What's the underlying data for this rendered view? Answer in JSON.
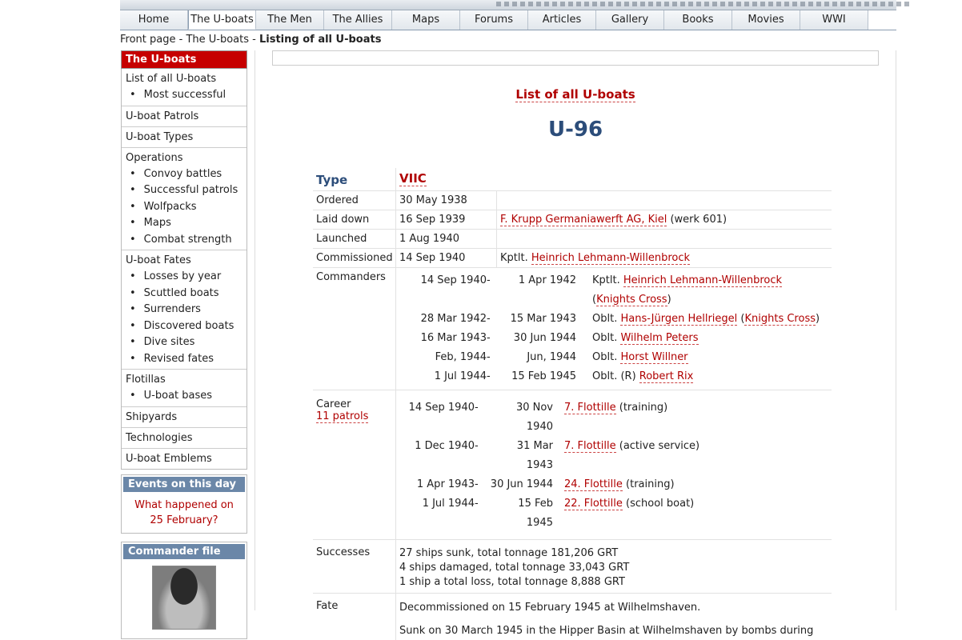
{
  "nav": [
    "Home",
    "The U-boats",
    "The Men",
    "The Allies",
    "Maps",
    "Forums",
    "Articles",
    "Gallery",
    "Books",
    "Movies",
    "WWI"
  ],
  "nav_active": 1,
  "breadcrumb": {
    "a": "Front page",
    "sep": " - ",
    "b": "The U-boats",
    "c": "Listing of all U-boats"
  },
  "sidebar": {
    "header": "The U-boats",
    "groups": [
      {
        "title": "List of all U-boats",
        "items": [
          "Most successful"
        ]
      },
      {
        "title": "U-boat Patrols",
        "items": []
      },
      {
        "title": "U-boat Types",
        "items": []
      },
      {
        "title": "Operations",
        "items": [
          "Convoy battles",
          "Successful patrols",
          "Wolfpacks",
          "Maps",
          "Combat strength"
        ]
      },
      {
        "title": "U-boat Fates",
        "items": [
          "Losses by year",
          "Scuttled boats",
          "Surrenders",
          "Discovered boats",
          "Dive sites",
          "Revised fates"
        ]
      },
      {
        "title": "Flotillas",
        "items": [
          "U-boat bases"
        ]
      },
      {
        "title": "Shipyards",
        "items": []
      },
      {
        "title": "Technologies",
        "items": []
      },
      {
        "title": "U-boat Emblems",
        "items": []
      }
    ],
    "events_title": "Events on this day",
    "events_text": "What happened on 25 February?",
    "commander_title": "Commander file"
  },
  "main": {
    "list_link": "List of all U-boats",
    "boat": "U-96",
    "type_label": "Type",
    "type_value": "VIIC",
    "ordered_label": "Ordered",
    "ordered_value": "30 May 1938",
    "laid_label": "Laid down",
    "laid_value": "16 Sep 1939",
    "laid_yard": "F. Krupp Germaniawerft AG, Kiel",
    "laid_extra": " (werk 601)",
    "launched_label": "Launched",
    "launched_value": "1 Aug 1940",
    "comm_label": "Commissioned",
    "comm_value": "14 Sep 1940",
    "comm_rank": "Kptlt. ",
    "comm_name": "Heinrich Lehmann-Willenbrock",
    "commanders_label": "Commanders",
    "commanders": [
      {
        "from": "14 Sep 1940",
        "to": "1 Apr 1942",
        "rank": "Kptlt. ",
        "name": "Heinrich Lehmann-Willenbrock",
        "award": "Knights Cross"
      },
      {
        "from": "28 Mar 1942",
        "to": "15 Mar 1943",
        "rank": "Oblt. ",
        "name": "Hans-Jürgen Hellriegel",
        "award": "Knights Cross"
      },
      {
        "from": "16 Mar 1943",
        "to": "30 Jun 1944",
        "rank": "Oblt. ",
        "name": "Wilhelm Peters",
        "award": ""
      },
      {
        "from": "Feb, 1944",
        "to": "Jun, 1944",
        "rank": "Oblt. ",
        "name": "Horst Willner",
        "award": ""
      },
      {
        "from": "1 Jul 1944",
        "to": "15 Feb 1945",
        "rank": "Oblt. (R) ",
        "name": "Robert Rix",
        "award": ""
      }
    ],
    "career_label": "Career",
    "career_patrols": "11 patrols",
    "career": [
      {
        "from": "14 Sep 1940",
        "to": "30 Nov 1940",
        "flot": "7. Flottille",
        "note": " (training)"
      },
      {
        "from": "1 Dec 1940",
        "to": "31 Mar 1943",
        "flot": "7. Flottille",
        "note": " (active service)"
      },
      {
        "from": "1 Apr 1943",
        "to": "30 Jun 1944",
        "flot": "24. Flottille",
        "note": " (training)"
      },
      {
        "from": "1 Jul 1944",
        "to": "15 Feb 1945",
        "flot": "22. Flottille",
        "note": " (school boat)"
      }
    ],
    "successes_label": "Successes",
    "successes": [
      "27 ships sunk, total tonnage 181,206 GRT",
      "4 ships damaged, total tonnage 33,043 GRT",
      "1 ship a total loss, total tonnage 8,888 GRT"
    ],
    "fate_label": "Fate",
    "fate": [
      "Decommissioned on 15 February 1945 at Wilhelmshaven.",
      "Sunk on 30 March 1945 in the Hipper Basin at Wilhelmshaven by bombs during"
    ]
  }
}
